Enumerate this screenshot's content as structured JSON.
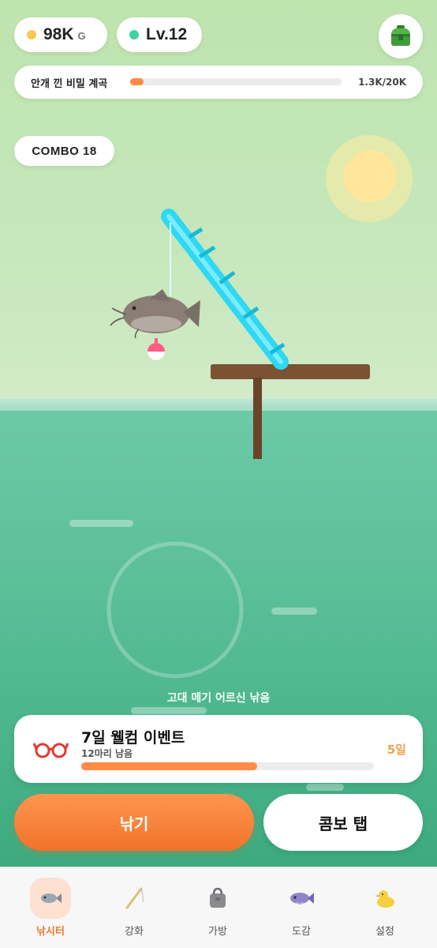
{
  "hud": {
    "gold_value": "98K",
    "gold_unit": "G",
    "level": "Lv.12",
    "gold_color": "#f8c94a",
    "level_color": "#3fd3a0",
    "shop_icon": "green-treasure-chest-icon"
  },
  "quest": {
    "title": "안개 낀 비밀 계곡",
    "progress_text": "1.3K/20K",
    "progress_fraction": 0.065
  },
  "combo": {
    "label": "COMBO 18"
  },
  "scene": {
    "catch_message": "고대 메기 어르신 낚음",
    "hooked_fish_icon": "catfish-icon",
    "rod_icon": "bamboo-fishing-rod-icon"
  },
  "event": {
    "title": "7일 웰컴 이벤트",
    "subtitle": "12마리 남음",
    "days_left": "5일",
    "progress_fraction": 0.6,
    "icon": "red-glasses-icon"
  },
  "buttons": {
    "fish": "낚기",
    "combo_tap": "콤보 탭"
  },
  "nav": {
    "items": [
      {
        "label": "낚시터",
        "icon": "fish-icon",
        "active": true
      },
      {
        "label": "강화",
        "icon": "fishing-rod-icon",
        "active": false
      },
      {
        "label": "가방",
        "icon": "bag-icon",
        "active": false
      },
      {
        "label": "도감",
        "icon": "encyclopedia-fish-icon",
        "active": false
      },
      {
        "label": "설정",
        "icon": "duck-icon",
        "active": false
      }
    ]
  },
  "colors": {
    "accent": "#f0782e",
    "sky": "#c6e7bc",
    "sea": "#58bd96"
  }
}
